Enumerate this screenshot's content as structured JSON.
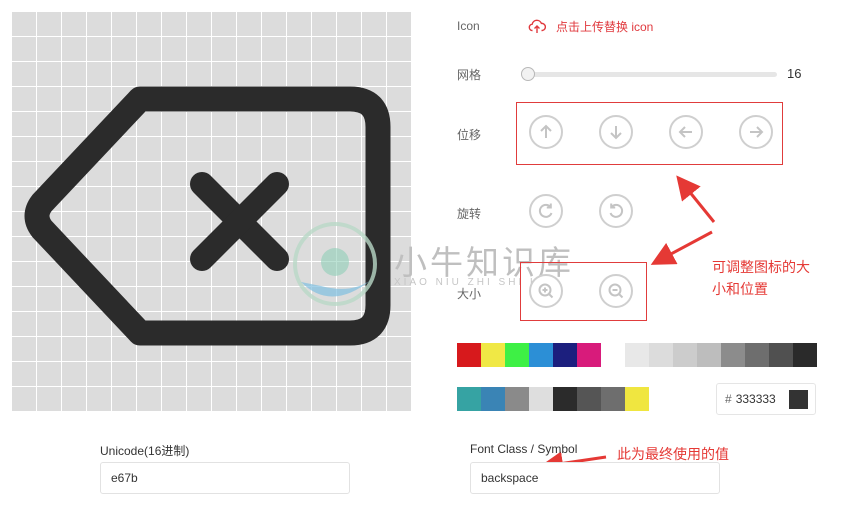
{
  "labels": {
    "icon": "Icon",
    "grid": "网格",
    "offset": "位移",
    "rotate": "旋转",
    "size": "大小"
  },
  "upload": {
    "label": "点击上传替换 icon",
    "icon": "upload-cloud-icon"
  },
  "grid": {
    "value": "16",
    "min": 16
  },
  "offset_buttons": [
    "arrow-up-icon",
    "arrow-down-icon",
    "arrow-left-icon",
    "arrow-right-icon"
  ],
  "rotate_buttons": [
    "rotate-clockwise-icon",
    "rotate-counterclockwise-icon"
  ],
  "size_buttons": [
    "zoom-in-icon",
    "zoom-out-icon"
  ],
  "palette_row1": [
    "#d7191c",
    "#f0e845",
    "#3ef045",
    "#2c8fd6",
    "#1c1f7e",
    "#d81b7b",
    "#ffffff",
    "#e8e8e8",
    "#dcdcdc",
    "#cccccc",
    "#bdbdbd",
    "#8c8c8c",
    "#6e6e6e",
    "#505050",
    "#2a2a2a"
  ],
  "palette_row2": [
    "#36a3a3",
    "#3a84b5",
    "#8a8a8a",
    "#dedede",
    "#2b2b2b",
    "#555555",
    "#6e6e6e",
    "#f0e640"
  ],
  "color": {
    "hash": "#",
    "value": "333333",
    "swatch": "#333333"
  },
  "unicode": {
    "label": "Unicode(16进制)",
    "value": "e67b"
  },
  "font_class": {
    "label": "Font Class / Symbol",
    "value": "backspace"
  },
  "annotations": {
    "adjust": "可调整图标的大小和位置",
    "final": "此为最终使用的值"
  },
  "watermark": {
    "title": "小牛知识库",
    "subtitle": "XIAO NIU ZHI SHI KU"
  },
  "colors": {
    "accent": "#e0393e",
    "icon": "#2b2b2b"
  }
}
